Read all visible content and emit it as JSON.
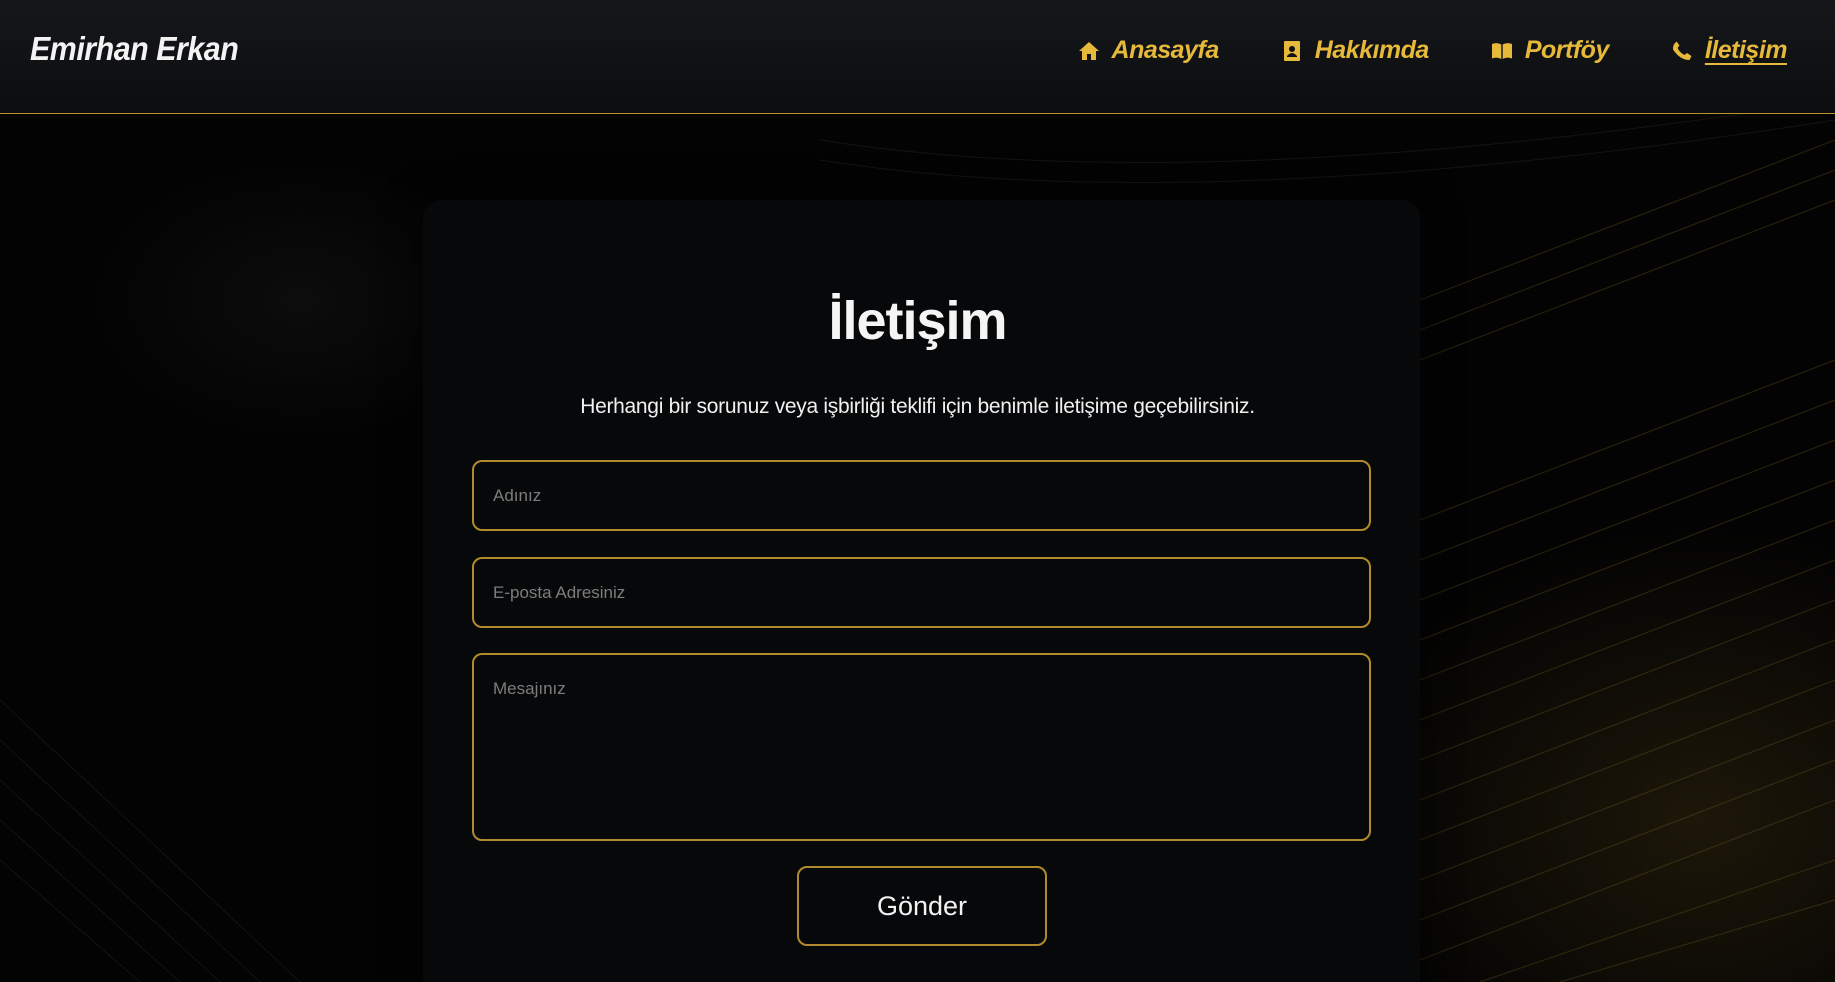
{
  "header": {
    "brand": "Emirhan Erkan",
    "nav": [
      {
        "label": "Anasayfa",
        "icon": "home-icon"
      },
      {
        "label": "Hakkımda",
        "icon": "contact-card-icon"
      },
      {
        "label": "Portföy",
        "icon": "open-book-icon"
      },
      {
        "label": "İletişim",
        "icon": "phone-icon"
      }
    ]
  },
  "contact": {
    "title": "İletişim",
    "subtitle": "Herhangi bir sorunuz veya işbirliği teklifi için benimle iletişime geçebilirsiniz.",
    "name_placeholder": "Adınız",
    "email_placeholder": "E-posta Adresiniz",
    "message_placeholder": "Mesajınız",
    "submit_label": "Gönder"
  },
  "colors": {
    "accent": "#e6b93a",
    "border": "#b08a2c",
    "background": "#030303"
  }
}
